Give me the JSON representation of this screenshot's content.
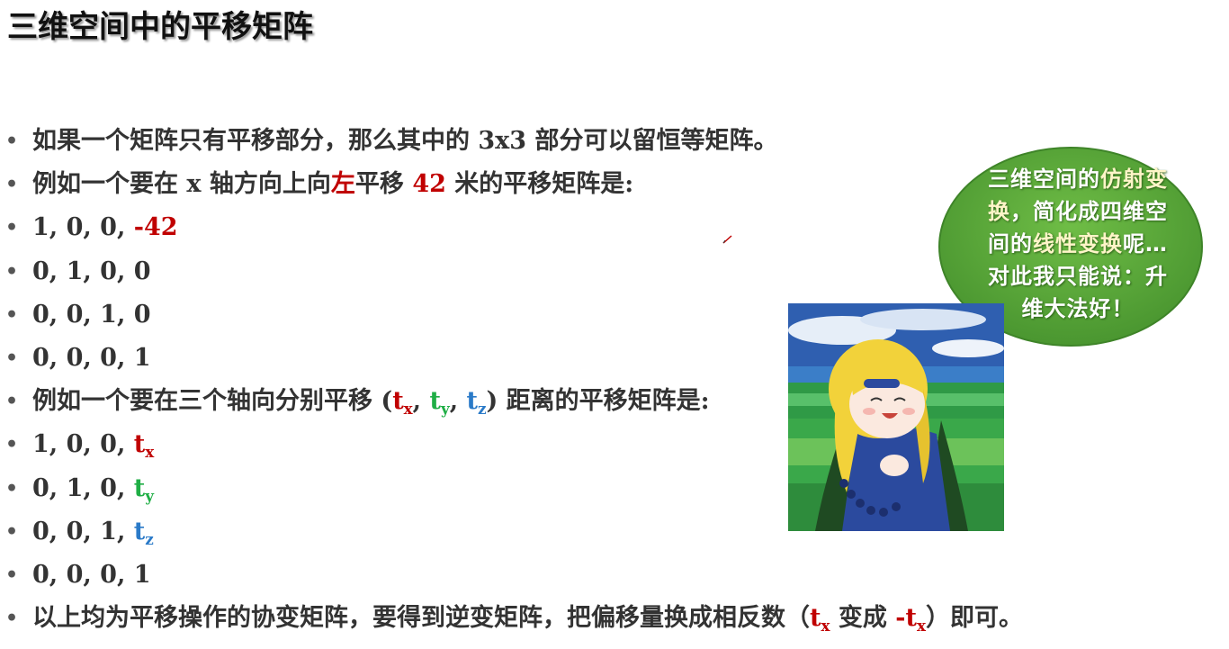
{
  "title": "三维空间中的平移矩阵",
  "bullets": {
    "b1": "如果一个矩阵只有平移部分，那么其中的 3x3 部分可以留恒等矩阵。",
    "b2": {
      "pre": "例如一个要在 x 轴方向上向",
      "dir": "左",
      "mid": "平移 ",
      "num": "42",
      "post": " 米的平移矩阵是:"
    },
    "r1": {
      "pre": "1, 0, 0, ",
      "val": "-42"
    },
    "r2": "0, 1, 0, 0",
    "r3": "0, 0, 1, 0",
    "r4": "0, 0, 0, 1",
    "b7": {
      "pre": "例如一个要在三个轴向分别平移 (",
      "comma": ", ",
      "post": ") 距离的平移矩阵是:"
    },
    "m1": {
      "pre": "1, 0, 0, "
    },
    "m2": {
      "pre": "0, 1, 0, "
    },
    "m3": {
      "pre": "0, 0, 1, "
    },
    "m4": "0, 0, 0, 1",
    "b12": {
      "pre": "以上均为平移操作的协变矩阵，要得到逆变矩阵，把偏移量换成相反数（",
      "mid": " 变成 ",
      "neg": "-",
      "post": "）即可。"
    }
  },
  "symbols": {
    "t": "t",
    "x": "x",
    "y": "y",
    "z": "z"
  },
  "bubble": {
    "l1a": "三维空间的",
    "l1b": "仿射变",
    "l2a": "换",
    "l2b": "，简化成四维空",
    "l3a": "间的",
    "l3b": "线性变换",
    "l3c": "呢…",
    "l4": "对此我只能说：升",
    "l5": "维大法好！"
  },
  "colors": {
    "red": "#c00000",
    "green": "#1fae45",
    "blue": "#2a7ac8",
    "bubble": "#5ea83a"
  },
  "icons": {
    "bubble": "speech-bubble-icon",
    "character": "anime-character-illustration",
    "pen": "pen-cursor-icon"
  }
}
